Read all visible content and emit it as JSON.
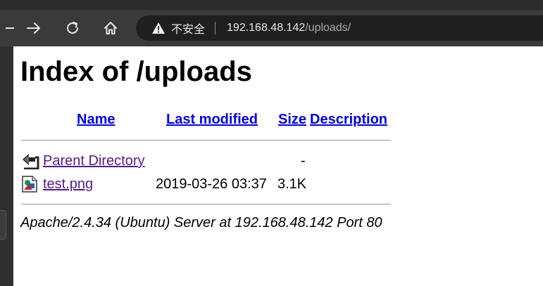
{
  "browser": {
    "security_label": "不安全",
    "url_host": "192.168.48.142",
    "url_path": "/uploads/"
  },
  "page": {
    "title": "Index of /uploads",
    "columns": {
      "name": "Name",
      "last_modified": "Last modified",
      "size": "Size",
      "description": "Description"
    },
    "entries": [
      {
        "name": "Parent Directory",
        "last_modified": "",
        "size": "-",
        "description": "",
        "icon": "back-icon"
      },
      {
        "name": "test.png",
        "last_modified": "2019-03-26 03:37",
        "size": "3.1K",
        "description": "",
        "icon": "image-icon"
      }
    ],
    "footer": "Apache/2.4.34 (Ubuntu) Server at 192.168.48.142 Port 80"
  }
}
